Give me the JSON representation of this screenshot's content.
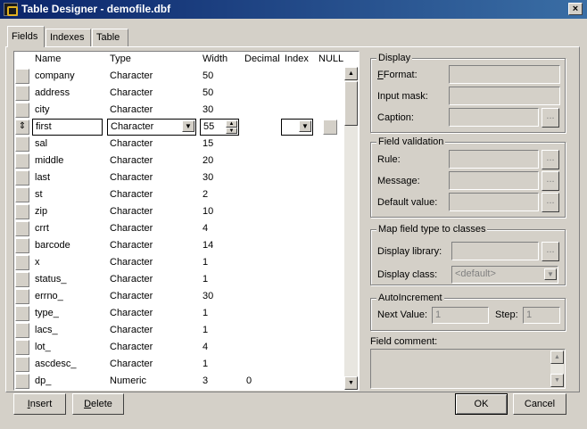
{
  "window": {
    "title": "Table Designer - demofile.dbf",
    "close": "×"
  },
  "tabs": [
    "Fields",
    "Indexes",
    "Table"
  ],
  "grid": {
    "headers": [
      "Name",
      "Type",
      "Width",
      "Decimal",
      "Index",
      "NULL"
    ],
    "rows": [
      {
        "name": "company",
        "type": "Character",
        "width": "50",
        "decimal": ""
      },
      {
        "name": "address",
        "type": "Character",
        "width": "50",
        "decimal": ""
      },
      {
        "name": "city",
        "type": "Character",
        "width": "30",
        "decimal": ""
      },
      {
        "name": "first",
        "type": "Character",
        "width": "55",
        "decimal": ""
      },
      {
        "name": "sal",
        "type": "Character",
        "width": "15",
        "decimal": ""
      },
      {
        "name": "middle",
        "type": "Character",
        "width": "20",
        "decimal": ""
      },
      {
        "name": "last",
        "type": "Character",
        "width": "30",
        "decimal": ""
      },
      {
        "name": "st",
        "type": "Character",
        "width": "2",
        "decimal": ""
      },
      {
        "name": "zip",
        "type": "Character",
        "width": "10",
        "decimal": ""
      },
      {
        "name": "crrt",
        "type": "Character",
        "width": "4",
        "decimal": ""
      },
      {
        "name": "barcode",
        "type": "Character",
        "width": "14",
        "decimal": ""
      },
      {
        "name": "x",
        "type": "Character",
        "width": "1",
        "decimal": ""
      },
      {
        "name": "status_",
        "type": "Character",
        "width": "1",
        "decimal": ""
      },
      {
        "name": "errno_",
        "type": "Character",
        "width": "30",
        "decimal": ""
      },
      {
        "name": "type_",
        "type": "Character",
        "width": "1",
        "decimal": ""
      },
      {
        "name": "lacs_",
        "type": "Character",
        "width": "1",
        "decimal": ""
      },
      {
        "name": "lot_",
        "type": "Character",
        "width": "4",
        "decimal": ""
      },
      {
        "name": "ascdesc_",
        "type": "Character",
        "width": "1",
        "decimal": ""
      },
      {
        "name": "dp_",
        "type": "Numeric",
        "width": "3",
        "decimal": "0"
      }
    ],
    "active_row_index": 3,
    "row_selector_glyph": "⇕"
  },
  "display": {
    "title": "Display",
    "format": "Format:",
    "input_mask": "Input mask:",
    "caption": "Caption:"
  },
  "validation": {
    "title": "Field validation",
    "rule": "Rule:",
    "message": "Message:",
    "default_value": "Default value:"
  },
  "map": {
    "title": "Map field type to classes",
    "display_library": "Display library:",
    "display_class": "Display class:",
    "display_class_value": "<default>"
  },
  "autoinc": {
    "title": "AutoIncrement",
    "next_value": "Next Value:",
    "step": "Step:",
    "next_value_val": "1",
    "step_val": "1"
  },
  "comment": {
    "label": "Field comment:"
  },
  "buttons": {
    "insert": "Insert",
    "delete": "Delete",
    "ok": "OK",
    "cancel": "Cancel",
    "ellipsis": "..."
  }
}
